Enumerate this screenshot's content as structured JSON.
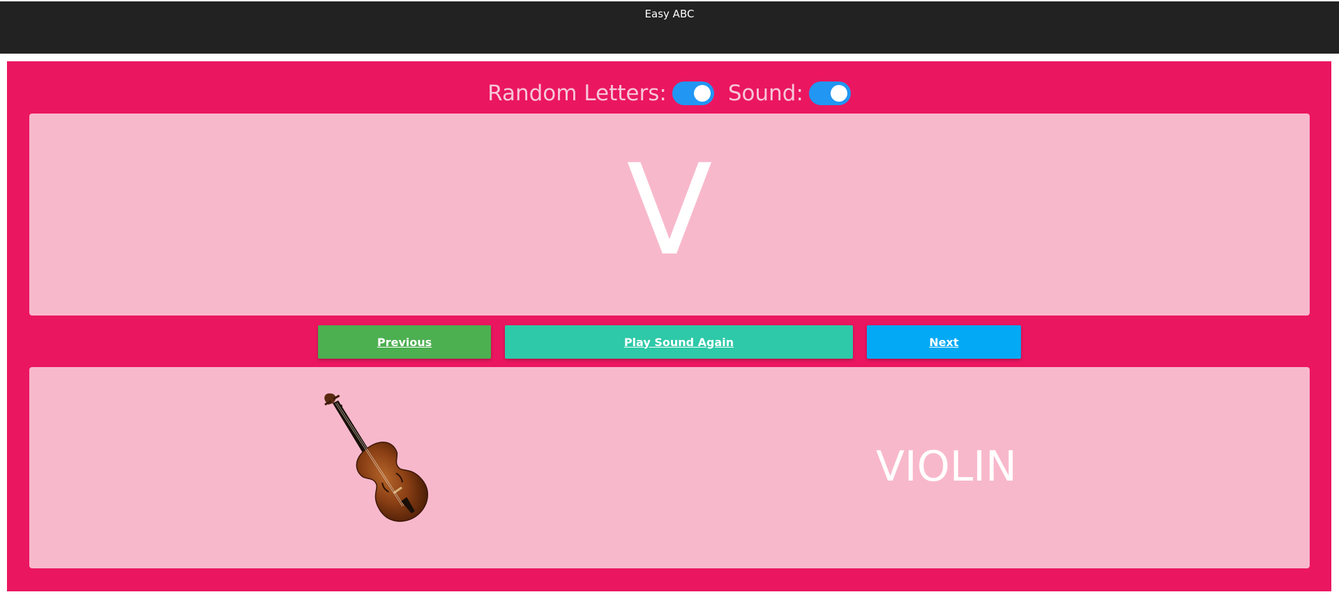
{
  "app": {
    "title": "Easy ABC"
  },
  "toggles": {
    "random_letters": {
      "label": "Random Letters:",
      "on": true
    },
    "sound": {
      "label": "Sound:",
      "on": true
    }
  },
  "card": {
    "letter": "V",
    "word": "VIOLIN",
    "image": "violin"
  },
  "buttons": {
    "previous": "Previous",
    "play_again": "Play Sound Again",
    "next": "Next"
  },
  "colors": {
    "topbar": "#222222",
    "main_bg": "#eb1660",
    "card_bg": "#f8b8cc",
    "toggle_on": "#2196f3",
    "previous_btn": "#4caf50",
    "play_btn": "#2ec9a8",
    "next_btn": "#03a9f4"
  }
}
